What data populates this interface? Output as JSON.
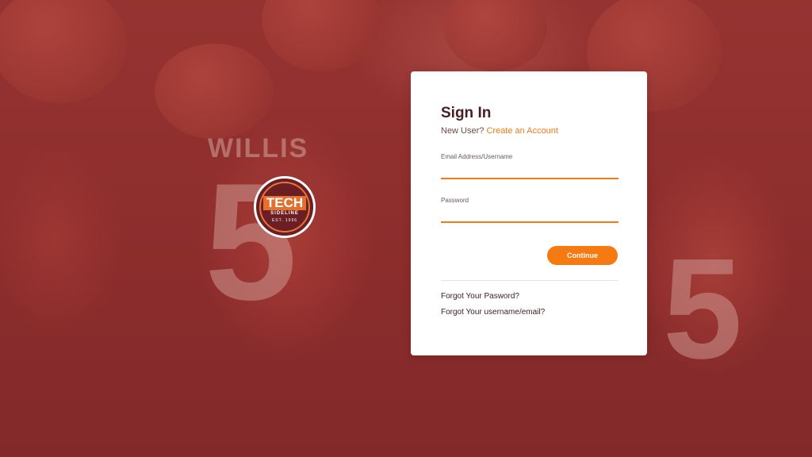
{
  "background": {
    "jersey_name": "WILLIS",
    "jersey_number": "5",
    "right_jersey_number": "5"
  },
  "logo": {
    "title": "TECH",
    "subtitle": "SIDELINE",
    "est": "EST. 1996"
  },
  "signin": {
    "title": "Sign In",
    "new_user_text": "New User?",
    "create_account_label": "Create an Account",
    "email_label": "Email Address/Username",
    "email_value": "",
    "password_label": "Password",
    "password_value": "",
    "continue_label": "Continue",
    "forgot_password_label": "Forgot Your Pasword?",
    "forgot_username_label": "Forgot Your username/email?"
  },
  "colors": {
    "accent": "#f57a12",
    "title": "#4b1c20",
    "background": "#8e2f2f"
  }
}
